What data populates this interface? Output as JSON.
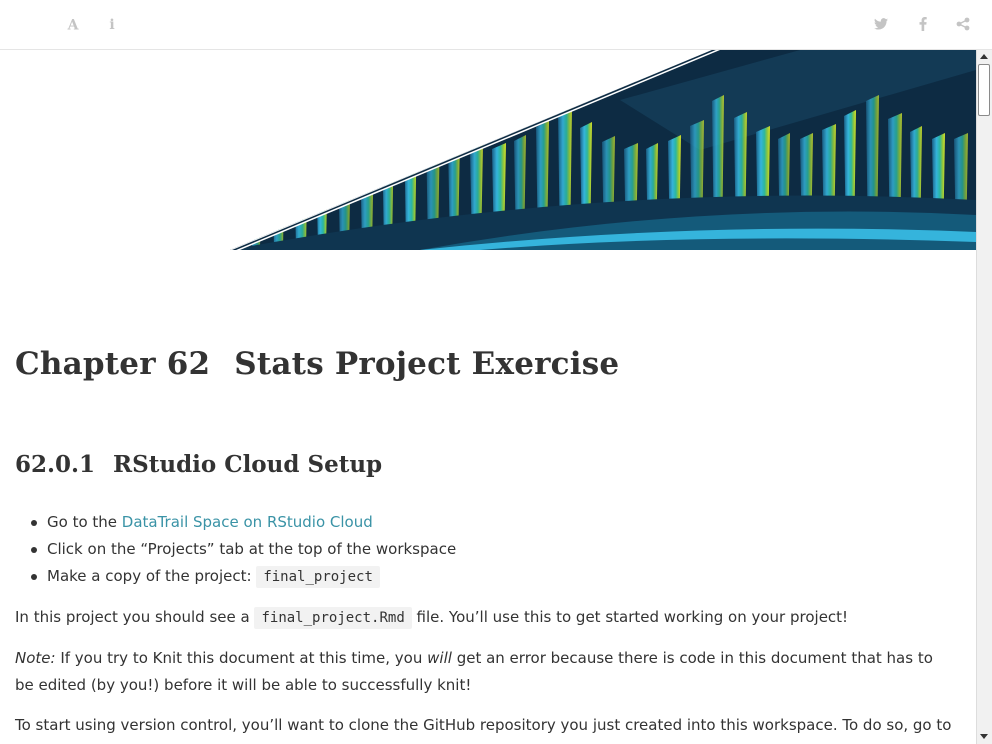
{
  "toolbar": {
    "left": [
      {
        "icon": "font-settings-icon",
        "glyph": "A"
      },
      {
        "icon": "info-icon",
        "glyph": "i"
      }
    ],
    "right": [
      {
        "icon": "twitter-icon"
      },
      {
        "icon": "facebook-icon"
      },
      {
        "icon": "share-icon"
      }
    ],
    "icon_color": "#c4c4c4"
  },
  "banner": {
    "colors": [
      "#0d2b43",
      "#1a6a8a",
      "#34b6dc",
      "#2bb6a0",
      "#8bc53f",
      "#d8e22a"
    ]
  },
  "chapter": {
    "number": "Chapter 62",
    "title": "Stats Project Exercise"
  },
  "section": {
    "number": "62.0.1",
    "title": "RStudio Cloud Setup"
  },
  "steps": {
    "s1_prefix": "Go to the ",
    "s1_link": "DataTrail Space on RStudio Cloud",
    "s2": "Click on the “Projects” tab at the top of the workspace",
    "s3_prefix": "Make a copy of the project: ",
    "s3_code": "final_project"
  },
  "paragraphs": {
    "p1_prefix": "In this project you should see a ",
    "p1_code": "final_project.Rmd",
    "p1_suffix": " file. You’ll use this to get started working on your project!",
    "p2_note": "Note:",
    "p2_a": " If you try to Knit this document at this time, you ",
    "p2_will": "will",
    "p2_b": " get an error because there is code in this document that has to be edited (by you!) before it will be able to successfully knit!",
    "p3": "To start using version control, you’ll want to clone the GitHub repository you just created into this workspace. To do so, go to"
  },
  "colors": {
    "link": "#3a93a6",
    "text": "#333333",
    "code_bg": "#f2f2f2"
  }
}
